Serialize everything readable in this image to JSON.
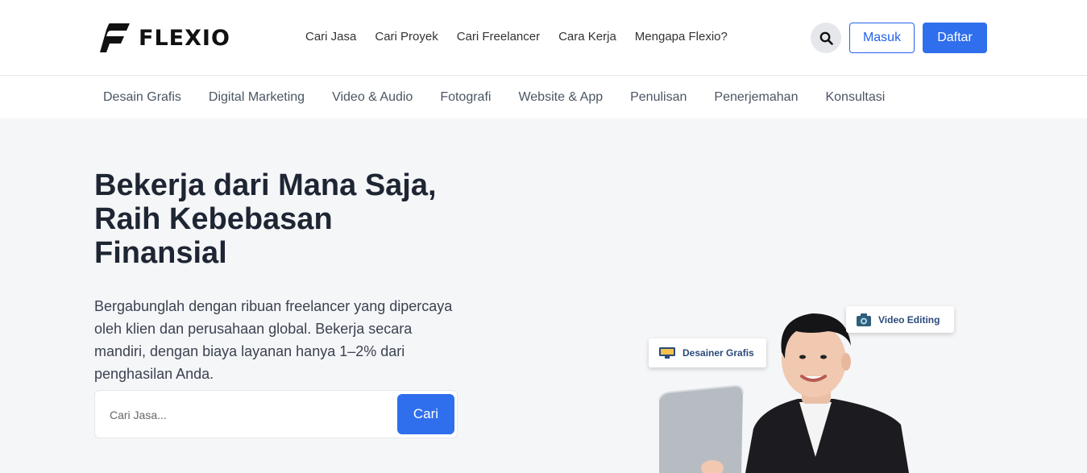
{
  "brand": {
    "name": "FLEXIO",
    "color": "#111111",
    "accent": "#2f6fed"
  },
  "nav": {
    "links": [
      "Cari Jasa",
      "Cari Proyek",
      "Cari Freelancer",
      "Cara Kerja",
      "Mengapa Flexio?"
    ],
    "search_icon": "search-icon",
    "login_label": "Masuk",
    "register_label": "Daftar"
  },
  "categories": [
    "Desain Grafis",
    "Digital Marketing",
    "Video & Audio",
    "Fotografi",
    "Website & App",
    "Penulisan",
    "Penerjemahan",
    "Konsultasi"
  ],
  "hero": {
    "title_lines": [
      "Bekerja dari Mana Saja,",
      "Raih Kebebasan",
      "Finansial"
    ],
    "description": "Bergabunglah dengan ribuan freelancer yang dipercaya oleh klien dan perusahaan global. Bekerja secara mandiri, dengan biaya layanan hanya 1–2% dari penghasilan Anda.",
    "search": {
      "placeholder": "Cari Jasa...",
      "button_label": "Cari"
    },
    "tags": {
      "video": "Video Editing",
      "design": "Desainer Grafis"
    }
  }
}
